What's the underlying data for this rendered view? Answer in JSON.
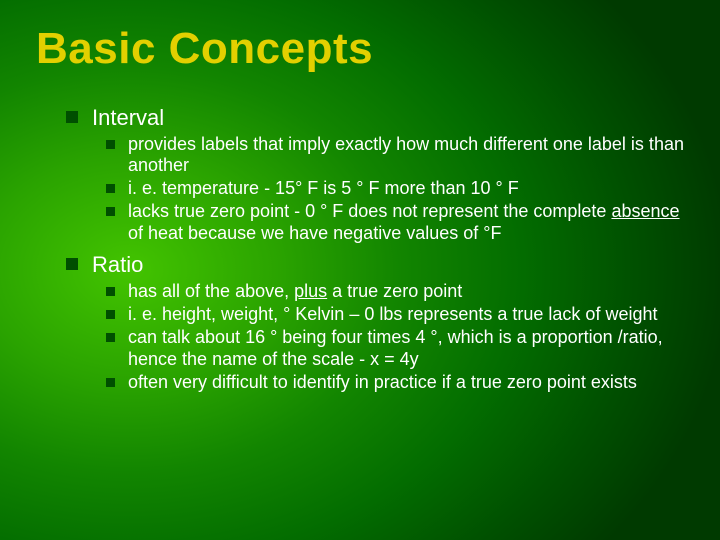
{
  "title": "Basic Concepts",
  "sections": [
    {
      "heading": "Interval",
      "sub": [
        {
          "segments": [
            {
              "t": "provides labels that imply exactly how much different one label is than another"
            }
          ]
        },
        {
          "segments": [
            {
              "t": "i. e. temperature - 15° F is 5 ° F more than  10 ° F"
            }
          ]
        },
        {
          "segments": [
            {
              "t": "lacks true zero point - 0 ° F does not represent the complete "
            },
            {
              "t": "absence",
              "u": true
            },
            {
              "t": " of heat because we have negative values of °F"
            }
          ]
        }
      ]
    },
    {
      "heading": "Ratio",
      "sub": [
        {
          "segments": [
            {
              "t": "has all of the above, "
            },
            {
              "t": "plus",
              "u": true
            },
            {
              "t": " a true zero point"
            }
          ]
        },
        {
          "segments": [
            {
              "t": "i. e. height, weight, ° Kelvin – 0 lbs represents a true lack of weight"
            }
          ]
        },
        {
          "segments": [
            {
              "t": "can talk about 16 ° being four times 4 °, which is a proportion /ratio, hence the name of the scale - x = 4y"
            }
          ]
        },
        {
          "segments": [
            {
              "t": "often very difficult to identify in practice if a true zero point exists"
            }
          ]
        }
      ]
    }
  ]
}
